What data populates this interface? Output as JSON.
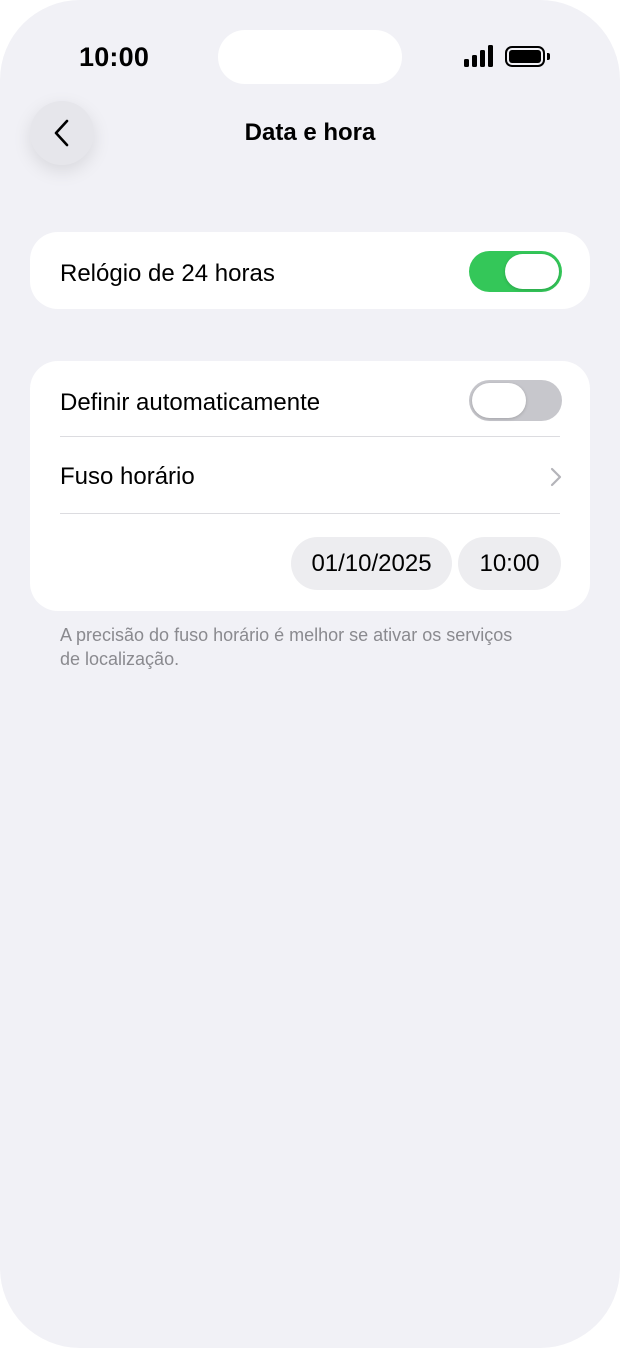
{
  "status_bar": {
    "time": "10:00",
    "icons": [
      "signal-icon",
      "battery-icon"
    ]
  },
  "header": {
    "title": "Data e hora",
    "back_icon": "chevron-left-icon"
  },
  "section_clock": {
    "label": "Relógio de 24 horas",
    "toggle_on": true
  },
  "section_auto": {
    "auto_label": "Definir automaticamente",
    "auto_toggle_on": false,
    "timezone_label": "Fuso horário",
    "timezone_icon": "chevron-right-icon",
    "date_value": "01/10/2025",
    "time_value": "10:00"
  },
  "footnote": "A precisão do fuso horário é melhor se ativar os serviços de localização.",
  "colors": {
    "background": "#f1f1f6",
    "toggle_on": "#34c759",
    "toggle_off": "#c7c7cc",
    "secondary_text": "#8a8a8f"
  }
}
